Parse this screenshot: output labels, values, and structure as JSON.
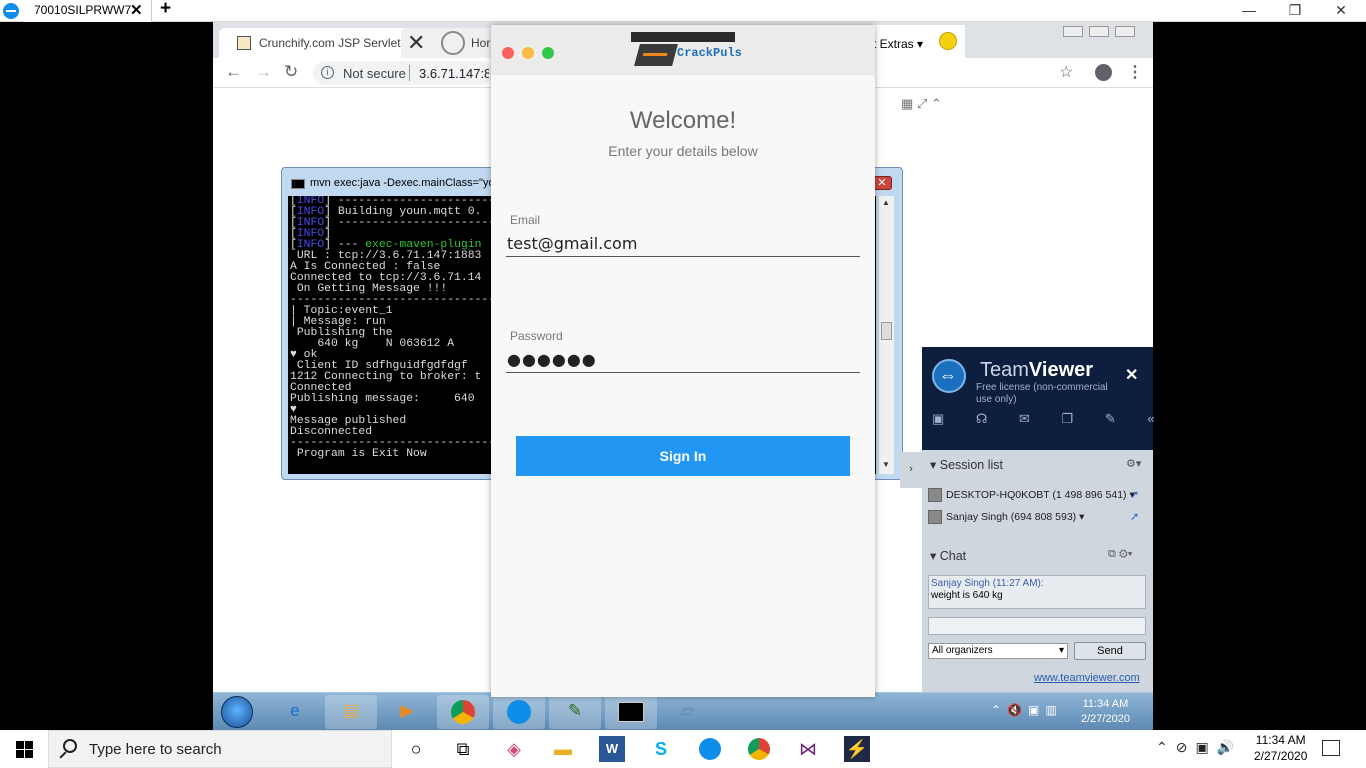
{
  "outer": {
    "tab_title": "70010SILPRWW7",
    "tab_close": "✕",
    "new_tab": "+",
    "minimize": "—",
    "restore": "❐",
    "close": "✕"
  },
  "chrome": {
    "tab1_title": "Crunchify.com JSP Servlet Exar",
    "tab2_close": "✕",
    "tab2_title": "Hor",
    "security_label": "Not secure",
    "url": "3.6.71.147:80",
    "extras_label": "t Extras ▾"
  },
  "cmd": {
    "title": "mvn  exec:java -Dexec.mainClass=\"yo",
    "lines": [
      "[INFO] ------------------------------------------",
      "[INFO] Building youn.mqtt 0.",
      "[INFO] ------------------------------------------",
      "[INFO]",
      "[INFO] --- exec-maven-plugin",
      " URL : tcp://3.6.71.147:1883",
      "A Is Connected : false",
      "Connected to tcp://3.6.71.14",
      " On Getting Message !!!",
      "------------------------------------------",
      "| Topic:event_1",
      "| Message: run",
      " Publishing the",
      "    640 kg    N 063612 A",
      "♥ ok",
      " Client ID sdfhguidfgdfdgf",
      "1212 Connecting to broker: t",
      "Connected",
      "Publishing message:     640",
      "♥",
      "Message published",
      "Disconnected",
      "------------------------------------------",
      " Program is Exit Now",
      ""
    ]
  },
  "login": {
    "brand_name": "CrackPuls",
    "welcome": "Welcome!",
    "subtitle": "Enter your details below",
    "email_label": "Email",
    "email_value": "test@gmail.com",
    "password_label": "Password",
    "password_value": "●●●●●●",
    "sign_in": "Sign In",
    "dot_colors": [
      "#fc605c",
      "#fdbc40",
      "#34c84a"
    ],
    "button_color": "#2196f3"
  },
  "teamviewer": {
    "brand_light": "Team",
    "brand_bold": "Viewer",
    "license": "Free license (non-commercial use only)",
    "close": "✕",
    "tools": "▣ ☊ ✉ ❐ ✎ «",
    "session_list": "Session list",
    "sessions": [
      {
        "name": "DESKTOP-HQ0KOBT (1 498 896 541)"
      },
      {
        "name": "Sanjay Singh (694 808 593)"
      }
    ],
    "chat": "Chat",
    "chat_who": "Sanjay Singh (11:27 AM):",
    "chat_msg": "weight is 640 kg",
    "organizers": "All organizers",
    "send": "Send",
    "link": "www.teamviewer.com"
  },
  "win7": {
    "time": "11:34 AM",
    "date": "2/27/2020"
  },
  "win10": {
    "search_placeholder": "Type here to search",
    "time": "11:34 AM",
    "date": "2/27/2020"
  }
}
